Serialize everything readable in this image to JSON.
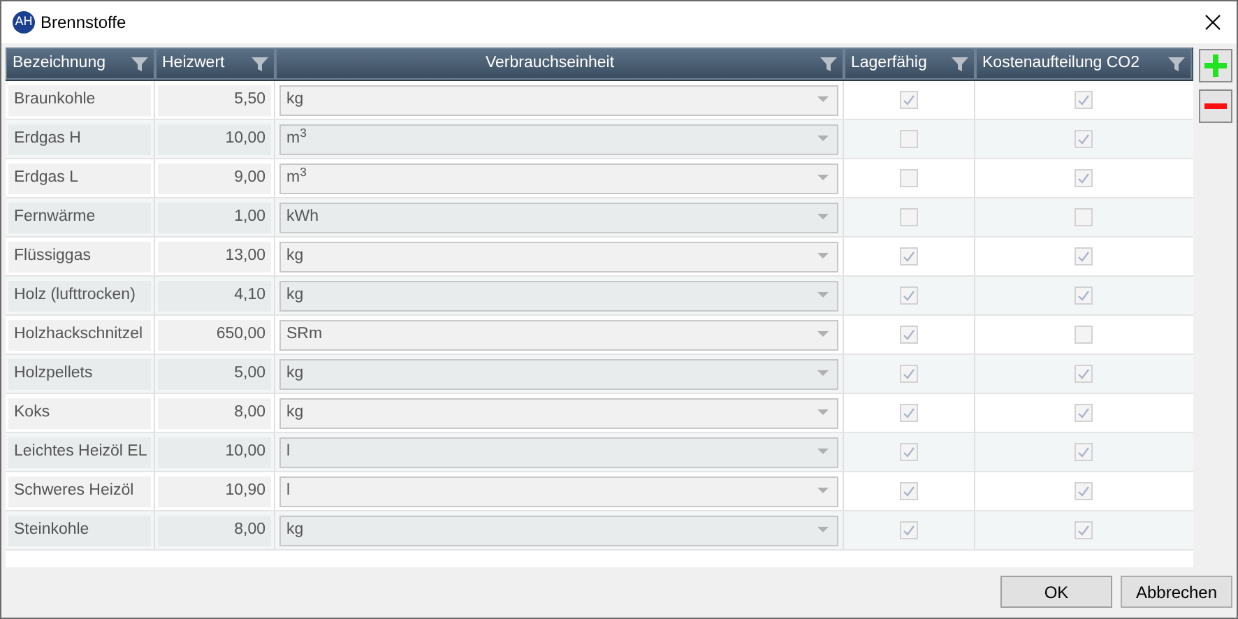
{
  "window": {
    "logo": "AH",
    "title": "Brennstoffe"
  },
  "table": {
    "columns": [
      {
        "label": "Bezeichnung"
      },
      {
        "label": "Heizwert"
      },
      {
        "label": "Verbrauchseinheit"
      },
      {
        "label": "Lagerfähig"
      },
      {
        "label": "Kostenaufteilung CO2"
      }
    ],
    "rows": [
      {
        "name": "Braunkohle",
        "heizwert": "5,50",
        "unit": "kg",
        "lagerfaehig": true,
        "co2": true
      },
      {
        "name": "Erdgas H",
        "heizwert": "10,00",
        "unit": "m$^{3}$",
        "lagerfaehig": false,
        "co2": true
      },
      {
        "name": "Erdgas L",
        "heizwert": "9,00",
        "unit": "m$^{3}$",
        "lagerfaehig": false,
        "co2": true
      },
      {
        "name": "Fernwärme",
        "heizwert": "1,00",
        "unit": "kWh",
        "lagerfaehig": false,
        "co2": false
      },
      {
        "name": "Flüssiggas",
        "heizwert": "13,00",
        "unit": "kg",
        "lagerfaehig": true,
        "co2": true
      },
      {
        "name": "Holz (lufttrocken)",
        "heizwert": "4,10",
        "unit": "kg",
        "lagerfaehig": true,
        "co2": true
      },
      {
        "name": "Holzhackschnitzel",
        "heizwert": "650,00",
        "unit": "SRm",
        "lagerfaehig": true,
        "co2": false
      },
      {
        "name": "Holzpellets",
        "heizwert": "5,00",
        "unit": "kg",
        "lagerfaehig": true,
        "co2": true
      },
      {
        "name": "Koks",
        "heizwert": "8,00",
        "unit": "kg",
        "lagerfaehig": true,
        "co2": true
      },
      {
        "name": "Leichtes Heizöl EL",
        "heizwert": "10,00",
        "unit": "l",
        "lagerfaehig": true,
        "co2": true
      },
      {
        "name": "Schweres Heizöl",
        "heizwert": "10,90",
        "unit": "l",
        "lagerfaehig": true,
        "co2": true
      },
      {
        "name": "Steinkohle",
        "heizwert": "8,00",
        "unit": "kg",
        "lagerfaehig": true,
        "co2": true
      }
    ]
  },
  "buttons": [
    "OK",
    "Abbrechen"
  ]
}
